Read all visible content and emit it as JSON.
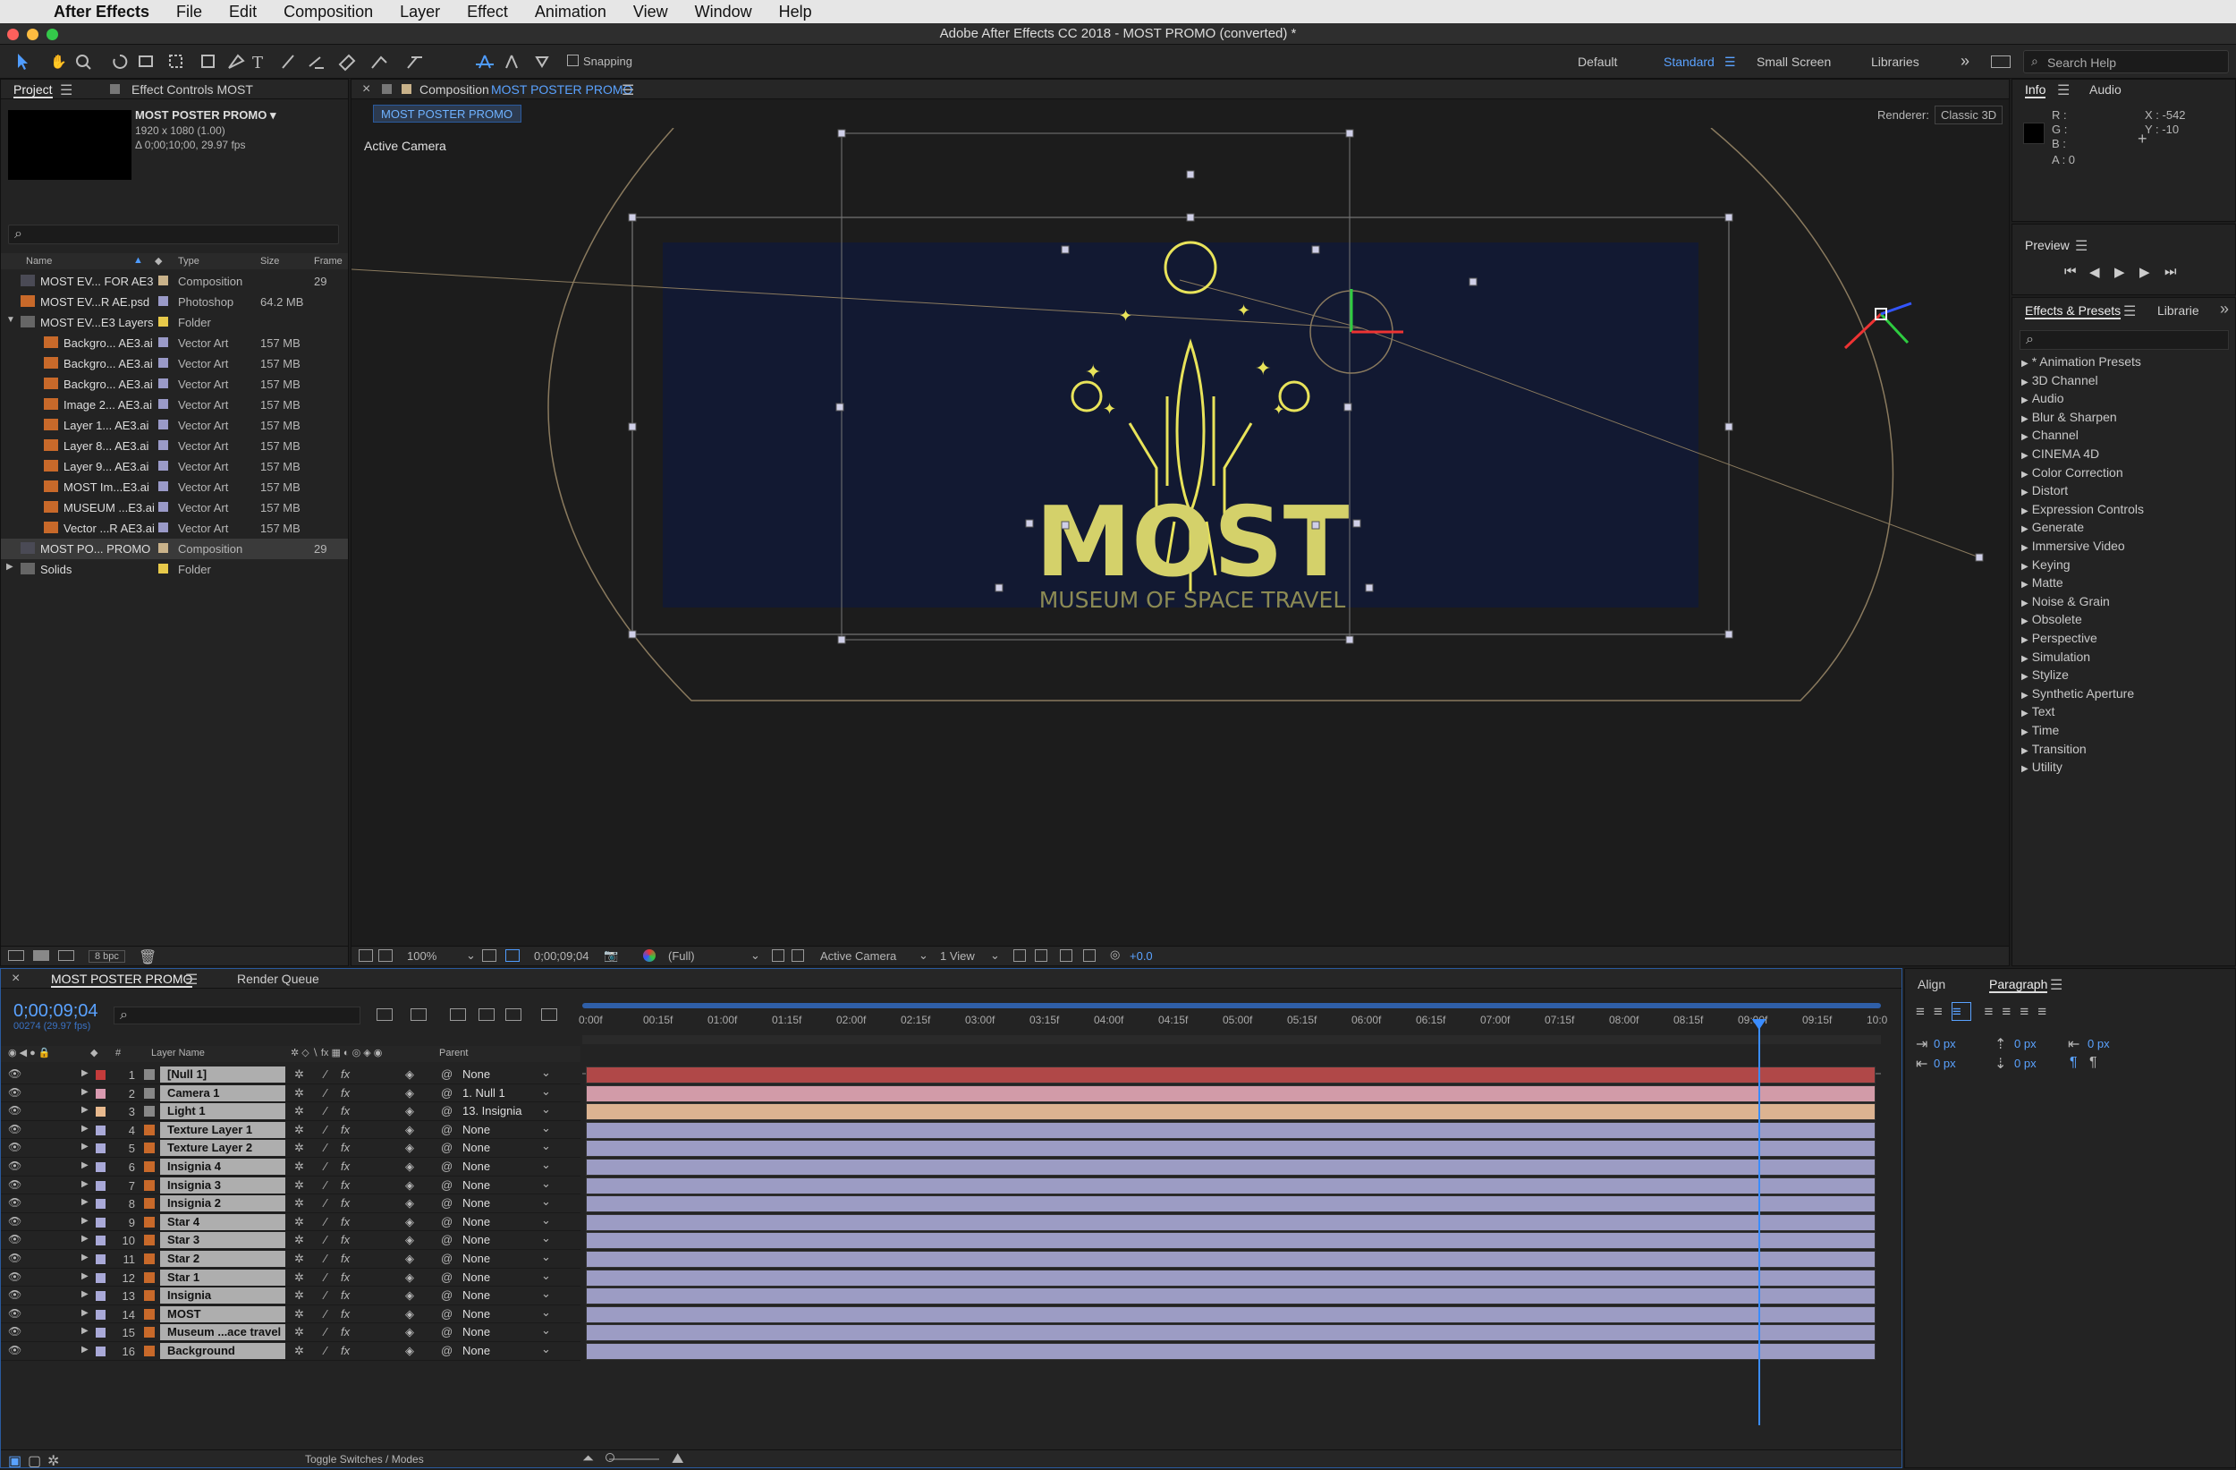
{
  "menubar": {
    "app": "After Effects",
    "items": [
      "File",
      "Edit",
      "Composition",
      "Layer",
      "Effect",
      "Animation",
      "View",
      "Window",
      "Help"
    ]
  },
  "window_title": "Adobe After Effects CC 2018 - MOST PROMO (converted) *",
  "toolbar": {
    "snapping": "Snapping",
    "workspaces": [
      "Default",
      "Standard",
      "Small Screen",
      "Libraries"
    ],
    "search_placeholder": "Search Help"
  },
  "project": {
    "tab": "Project",
    "tab2": "Effect Controls MOST",
    "comp_name": "MOST POSTER PROMO ▾",
    "comp_size": "1920 x 1080 (1.00)",
    "comp_duration": "Δ 0;00;10;00, 29.97 fps",
    "columns": [
      "Name",
      "Type",
      "Size",
      "Frame"
    ],
    "items": [
      {
        "name": "MOST EV... FOR AE3",
        "type": "Composition",
        "size": "",
        "frame": "29",
        "color": "#c9b28a"
      },
      {
        "name": "MOST EV...R AE.psd",
        "type": "Photoshop",
        "size": "64.2 MB",
        "frame": "",
        "color": "#9a9ac8"
      },
      {
        "name": "MOST EV...E3 Layers",
        "type": "Folder",
        "size": "",
        "frame": "",
        "color": "#e7c94a"
      },
      {
        "name": "Backgro... AE3.ai",
        "type": "Vector Art",
        "size": "157 MB",
        "frame": "",
        "color": "#9a9ac8"
      },
      {
        "name": "Backgro... AE3.ai",
        "type": "Vector Art",
        "size": "157 MB",
        "frame": "",
        "color": "#9a9ac8"
      },
      {
        "name": "Backgro... AE3.ai",
        "type": "Vector Art",
        "size": "157 MB",
        "frame": "",
        "color": "#9a9ac8"
      },
      {
        "name": "Image 2... AE3.ai",
        "type": "Vector Art",
        "size": "157 MB",
        "frame": "",
        "color": "#9a9ac8"
      },
      {
        "name": "Layer 1... AE3.ai",
        "type": "Vector Art",
        "size": "157 MB",
        "frame": "",
        "color": "#9a9ac8"
      },
      {
        "name": "Layer 8... AE3.ai",
        "type": "Vector Art",
        "size": "157 MB",
        "frame": "",
        "color": "#9a9ac8"
      },
      {
        "name": "Layer 9... AE3.ai",
        "type": "Vector Art",
        "size": "157 MB",
        "frame": "",
        "color": "#9a9ac8"
      },
      {
        "name": "MOST Im...E3.ai",
        "type": "Vector Art",
        "size": "157 MB",
        "frame": "",
        "color": "#9a9ac8"
      },
      {
        "name": "MUSEUM ...E3.ai",
        "type": "Vector Art",
        "size": "157 MB",
        "frame": "",
        "color": "#9a9ac8"
      },
      {
        "name": "Vector ...R AE3.ai",
        "type": "Vector Art",
        "size": "157 MB",
        "frame": "",
        "color": "#9a9ac8"
      },
      {
        "name": "MOST PO... PROMO",
        "type": "Composition",
        "size": "",
        "frame": "29",
        "color": "#c9b28a"
      },
      {
        "name": "Solids",
        "type": "Folder",
        "size": "",
        "frame": "",
        "color": "#e7c94a"
      }
    ],
    "bpc": "8 bpc"
  },
  "composition": {
    "tab_prefix": "Composition",
    "tab_name": "MOST POSTER PROMO",
    "subtab": "MOST POSTER PROMO",
    "renderer_label": "Renderer:",
    "renderer": "Classic 3D",
    "view_label": "Active Camera",
    "poster_title": "MOST",
    "poster_subtitle": "MUSEUM OF SPACE TRAVEL",
    "footer": {
      "zoom": "100%",
      "timecode": "0;00;09;04",
      "resolution": "(Full)",
      "camera": "Active Camera",
      "views": "1 View",
      "exposure": "+0.0"
    }
  },
  "info": {
    "tab": "Info",
    "tab2": "Audio",
    "r": "R :",
    "g": "G :",
    "b": "B :",
    "a": "A :  0",
    "x": "X : -542",
    "y": "Y : -10"
  },
  "preview": {
    "title": "Preview"
  },
  "effects": {
    "tab": "Effects & Presets",
    "tab2": "Librarie",
    "items": [
      "* Animation Presets",
      "3D Channel",
      "Audio",
      "Blur & Sharpen",
      "Channel",
      "CINEMA 4D",
      "Color Correction",
      "Distort",
      "Expression Controls",
      "Generate",
      "Immersive Video",
      "Keying",
      "Matte",
      "Noise & Grain",
      "Obsolete",
      "Perspective",
      "Simulation",
      "Stylize",
      "Synthetic Aperture",
      "Text",
      "Time",
      "Transition",
      "Utility"
    ]
  },
  "timeline": {
    "tab": "MOST POSTER PROMO",
    "tab2": "Render Queue",
    "timecode": "0;00;09;04",
    "timecode_sub": "00274 (29.97 fps)",
    "col_layer": "Layer Name",
    "col_parent": "Parent",
    "col_num": "#",
    "ruler": [
      "0:00f",
      "00:15f",
      "01:00f",
      "01:15f",
      "02:00f",
      "02:15f",
      "03:00f",
      "03:15f",
      "04:00f",
      "04:15f",
      "05:00f",
      "05:15f",
      "06:00f",
      "06:15f",
      "07:00f",
      "07:15f",
      "08:00f",
      "08:15f",
      "09:00f",
      "09:15f",
      "10:0"
    ],
    "playhead_time_s": 9.13,
    "layers": [
      {
        "num": "1",
        "name": "[Null 1]",
        "parent": "None",
        "color": "#c43b3b",
        "bar": "#b04848"
      },
      {
        "num": "2",
        "name": "Camera 1",
        "parent": "1. Null 1",
        "color": "#d99ab0",
        "bar": "#d29ba8"
      },
      {
        "num": "3",
        "name": "Light 1",
        "parent": "13. Insignia",
        "color": "#e8b98e",
        "bar": "#dcb391"
      },
      {
        "num": "4",
        "name": "Texture Layer 1",
        "parent": "None",
        "color": "#a9a9d8",
        "bar": "#9c9cc4"
      },
      {
        "num": "5",
        "name": "Texture Layer 2",
        "parent": "None",
        "color": "#a9a9d8",
        "bar": "#9c9cc4"
      },
      {
        "num": "6",
        "name": "Insignia 4",
        "parent": "None",
        "color": "#a9a9d8",
        "bar": "#9c9cc4"
      },
      {
        "num": "7",
        "name": "Insignia 3",
        "parent": "None",
        "color": "#a9a9d8",
        "bar": "#9c9cc4"
      },
      {
        "num": "8",
        "name": "Insignia 2",
        "parent": "None",
        "color": "#a9a9d8",
        "bar": "#9c9cc4"
      },
      {
        "num": "9",
        "name": "Star 4",
        "parent": "None",
        "color": "#a9a9d8",
        "bar": "#9c9cc4"
      },
      {
        "num": "10",
        "name": "Star 3",
        "parent": "None",
        "color": "#a9a9d8",
        "bar": "#9c9cc4"
      },
      {
        "num": "11",
        "name": "Star 2",
        "parent": "None",
        "color": "#a9a9d8",
        "bar": "#9c9cc4"
      },
      {
        "num": "12",
        "name": "Star 1",
        "parent": "None",
        "color": "#a9a9d8",
        "bar": "#9c9cc4"
      },
      {
        "num": "13",
        "name": "Insignia",
        "parent": "None",
        "color": "#a9a9d8",
        "bar": "#9c9cc4"
      },
      {
        "num": "14",
        "name": "MOST",
        "parent": "None",
        "color": "#a9a9d8",
        "bar": "#9c9cc4"
      },
      {
        "num": "15",
        "name": "Museum ...ace travel",
        "parent": "None",
        "color": "#a9a9d8",
        "bar": "#9c9cc4"
      },
      {
        "num": "16",
        "name": "Background",
        "parent": "None",
        "color": "#a9a9d8",
        "bar": "#9c9cc4"
      }
    ],
    "toggle_label": "Toggle Switches / Modes"
  },
  "paragraph": {
    "tab": "Align",
    "tab2": "Paragraph",
    "values": [
      "0 px",
      "0 px",
      "0 px",
      "0 px",
      "0 px"
    ]
  }
}
